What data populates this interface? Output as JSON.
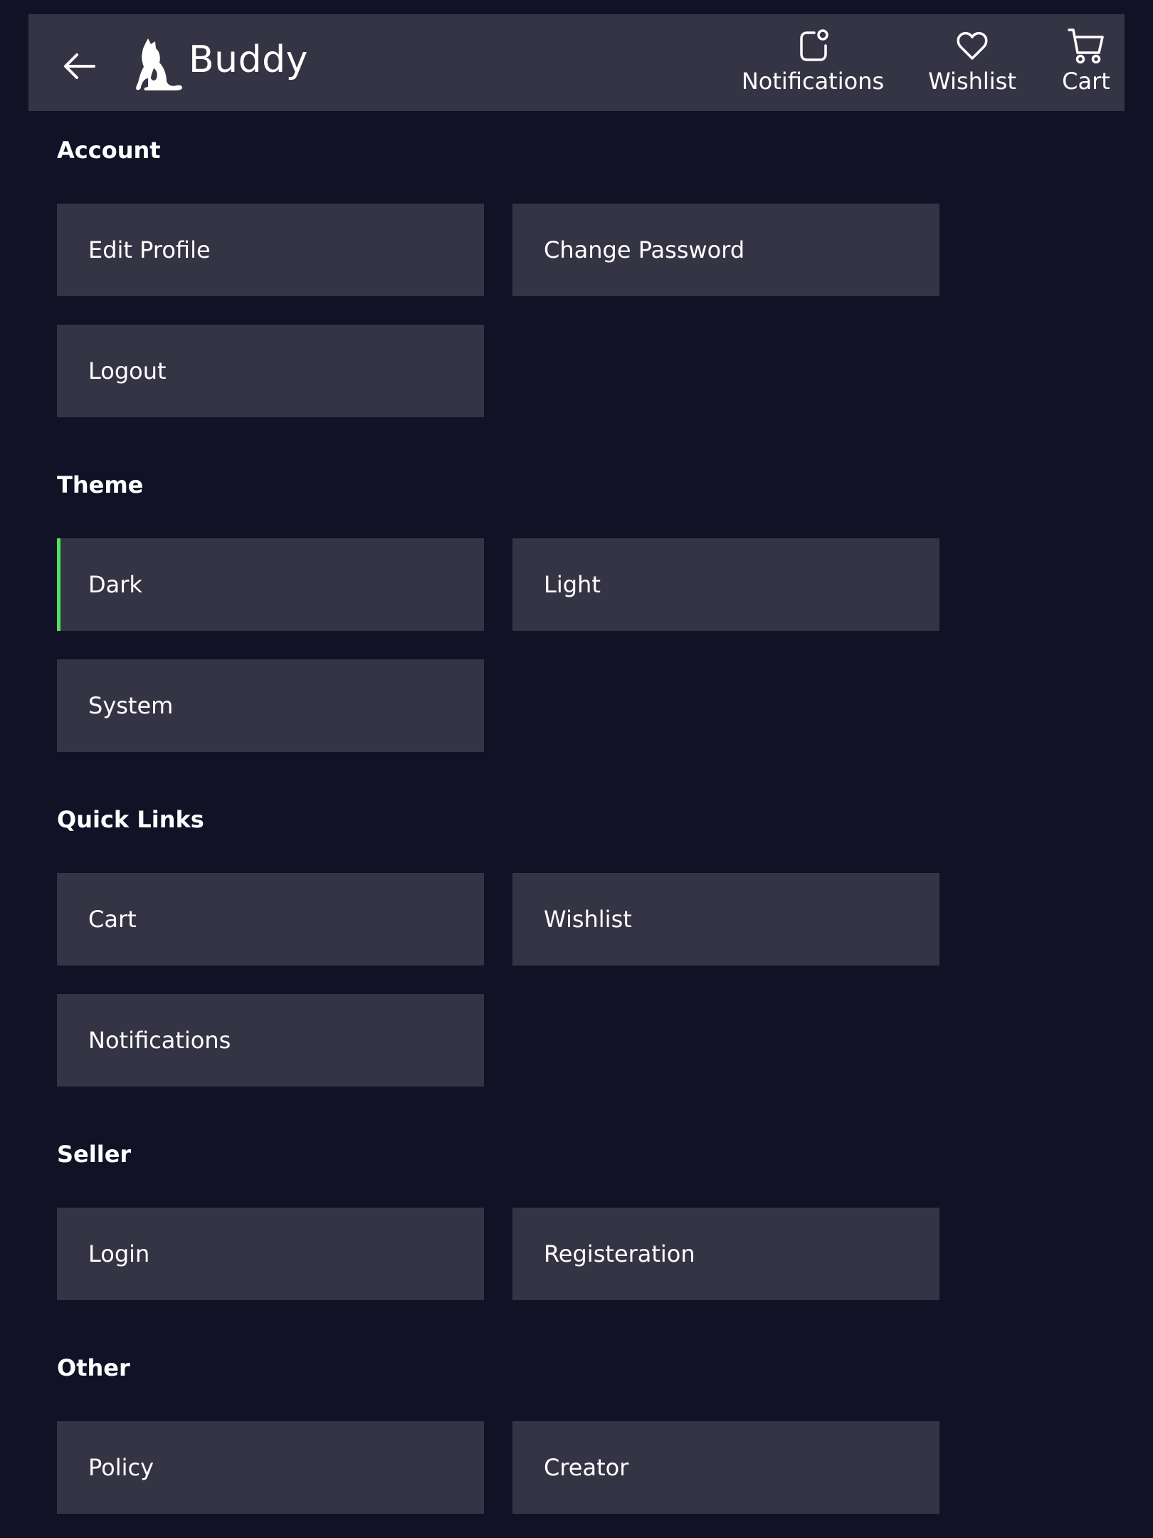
{
  "header": {
    "brand": "Buddy",
    "nav": {
      "notifications": "Notifications",
      "wishlist": "Wishlist",
      "cart": "Cart"
    }
  },
  "sections": {
    "account": {
      "title": "Account",
      "items": [
        "Edit Profile",
        "Change Password",
        "Logout"
      ]
    },
    "theme": {
      "title": "Theme",
      "items": [
        "Dark",
        "Light",
        "System"
      ],
      "selected": "Dark"
    },
    "quick_links": {
      "title": "Quick Links",
      "items": [
        "Cart",
        "Wishlist",
        "Notifications"
      ]
    },
    "seller": {
      "title": "Seller",
      "items": [
        "Login",
        "Registeration"
      ]
    },
    "other": {
      "title": "Other",
      "items": [
        "Policy",
        "Creator"
      ]
    }
  },
  "colors": {
    "background": "#111226",
    "surface": "#353445",
    "text": "#ffffff",
    "active_accent": "#4ee35a"
  },
  "icons": {
    "back": "arrow-left-icon",
    "logo": "dog-cat-logo",
    "notifications": "bell-badge-icon",
    "wishlist": "heart-icon",
    "cart": "cart-icon"
  }
}
